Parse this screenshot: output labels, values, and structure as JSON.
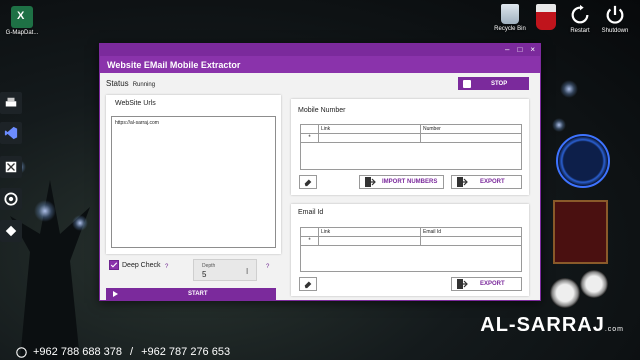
{
  "desktop": {
    "top_left_icon": {
      "label": "G-MapDat..."
    },
    "top_right_icons": [
      {
        "label": "Recycle Bin",
        "icon": "recycle-bin-icon"
      },
      {
        "label": "",
        "icon": "trash-can-icon"
      },
      {
        "label": "Restart",
        "icon": "restart-icon"
      },
      {
        "label": "Shutdown",
        "icon": "power-icon"
      }
    ]
  },
  "window": {
    "title": "Website EMail Mobile Extractor",
    "controls": [
      "–",
      "□",
      "×"
    ]
  },
  "status": {
    "label": "Status",
    "value": "Running"
  },
  "stop_button": "STOP",
  "website_urls": {
    "title": "WebSite Urls",
    "text": "https://al-sarraj.com"
  },
  "mobile_panel": {
    "title": "Mobile Number",
    "columns": [
      "Link",
      "Number"
    ],
    "row_marker": "*",
    "import_button": "IMPORT NUMBERS",
    "export_button": "EXPORT"
  },
  "email_panel": {
    "title": "Email Id",
    "columns": [
      "Link",
      "Email Id"
    ],
    "row_marker": "*",
    "export_button": "EXPORT"
  },
  "deep_check": {
    "label": "Deep Check",
    "checked": true,
    "help": "?"
  },
  "depth": {
    "label": "Depth",
    "value": "5",
    "help": "?"
  },
  "start_button": "START",
  "branding": {
    "watermark": "AL-SARRAJ",
    "watermark_suffix": ".com",
    "phone1": "+962 788 688 378",
    "separator": "/",
    "phone2": "+962 787 276 653"
  },
  "colors": {
    "accent": "#8a33ab",
    "accent_dark": "#7b2a9c"
  }
}
